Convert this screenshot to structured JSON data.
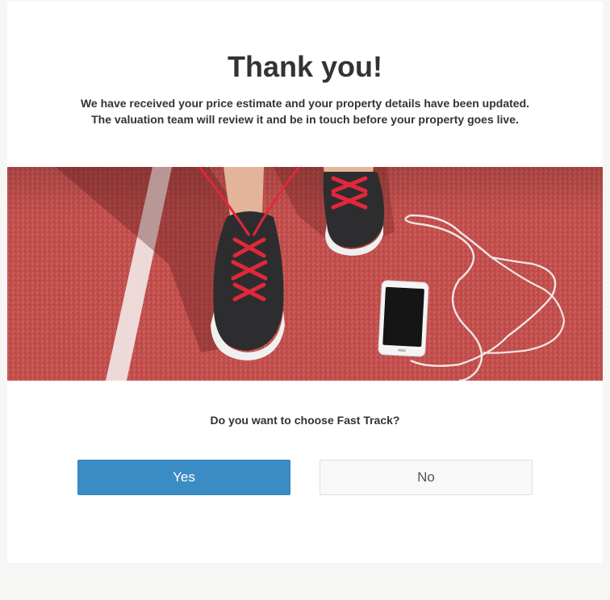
{
  "page": {
    "title": "Thank you!",
    "message_line_1": "We have received your price estimate and your property details have been updated.",
    "message_line_2": "The valuation team will review it and be in touch before your property goes live."
  },
  "hero_image": {
    "alt": "Runner's sneakers with red laces on a red running track next to a smartphone with earphones"
  },
  "fast_track": {
    "question": "Do you want to choose Fast Track?",
    "yes_label": "Yes",
    "no_label": "No"
  },
  "colors": {
    "primary_button": "#3b8cc4",
    "secondary_button": "#f8f8f8",
    "track_red": "#c4514f",
    "text": "#333333"
  }
}
